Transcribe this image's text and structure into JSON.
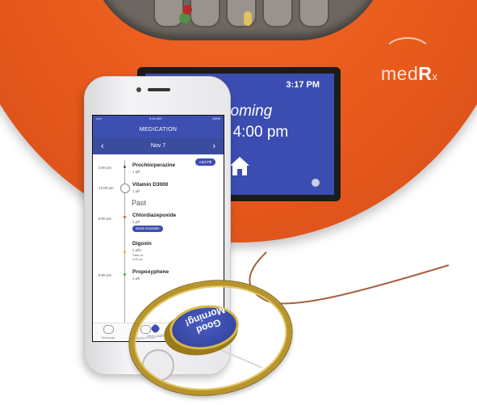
{
  "device": {
    "brand_prefix": "med",
    "brand_bold": "R",
    "brand_suffix": "x",
    "screen": {
      "time": "3:17 PM",
      "line1": "coming",
      "line2": "t 4:00 pm",
      "home_icon": "home-icon"
    }
  },
  "phone": {
    "status": {
      "carrier": "••••• ",
      "time": "9:41 AM",
      "battery": "100%"
    },
    "title": "MEDICATION",
    "date": "Nov 7",
    "prev_arrow": "‹",
    "next_arrow": "›",
    "add_pill": "Add Pill",
    "upcoming": [
      {
        "time": "3:00 pm",
        "name": "Prochlorperazine",
        "qty": "1 pill"
      },
      {
        "time": "12:00 pm",
        "name": "Vitamin D3000",
        "qty": "1 pill"
      }
    ],
    "past_label": "Past",
    "past": [
      {
        "time": "9:00 am",
        "name": "Chlordiazepoxide",
        "qty": "1 pill",
        "action": "Send reminder",
        "dot_color": "#e74c3c"
      },
      {
        "time": "",
        "name": "Digoxin",
        "qty": "2 pills",
        "taken_label": "Taken at",
        "taken_time": "9:25 am",
        "dot_color": "#f0b429"
      },
      {
        "time": "8:00 am",
        "name": "Propoxyphene",
        "qty": "1 pill",
        "dot_color": "#37b24d"
      }
    ],
    "tabs": [
      {
        "label": "Message",
        "icon": "message-icon"
      },
      {
        "label": "Appointments",
        "icon": "calendar-icon"
      },
      {
        "label": "Medication",
        "icon": "pill-icon"
      }
    ]
  },
  "button": {
    "line1": "Good",
    "line2": "Morning!"
  },
  "colors": {
    "device_orange": "#e85a1c",
    "screen_blue": "#3b4db0",
    "gold": "#b8952c"
  }
}
